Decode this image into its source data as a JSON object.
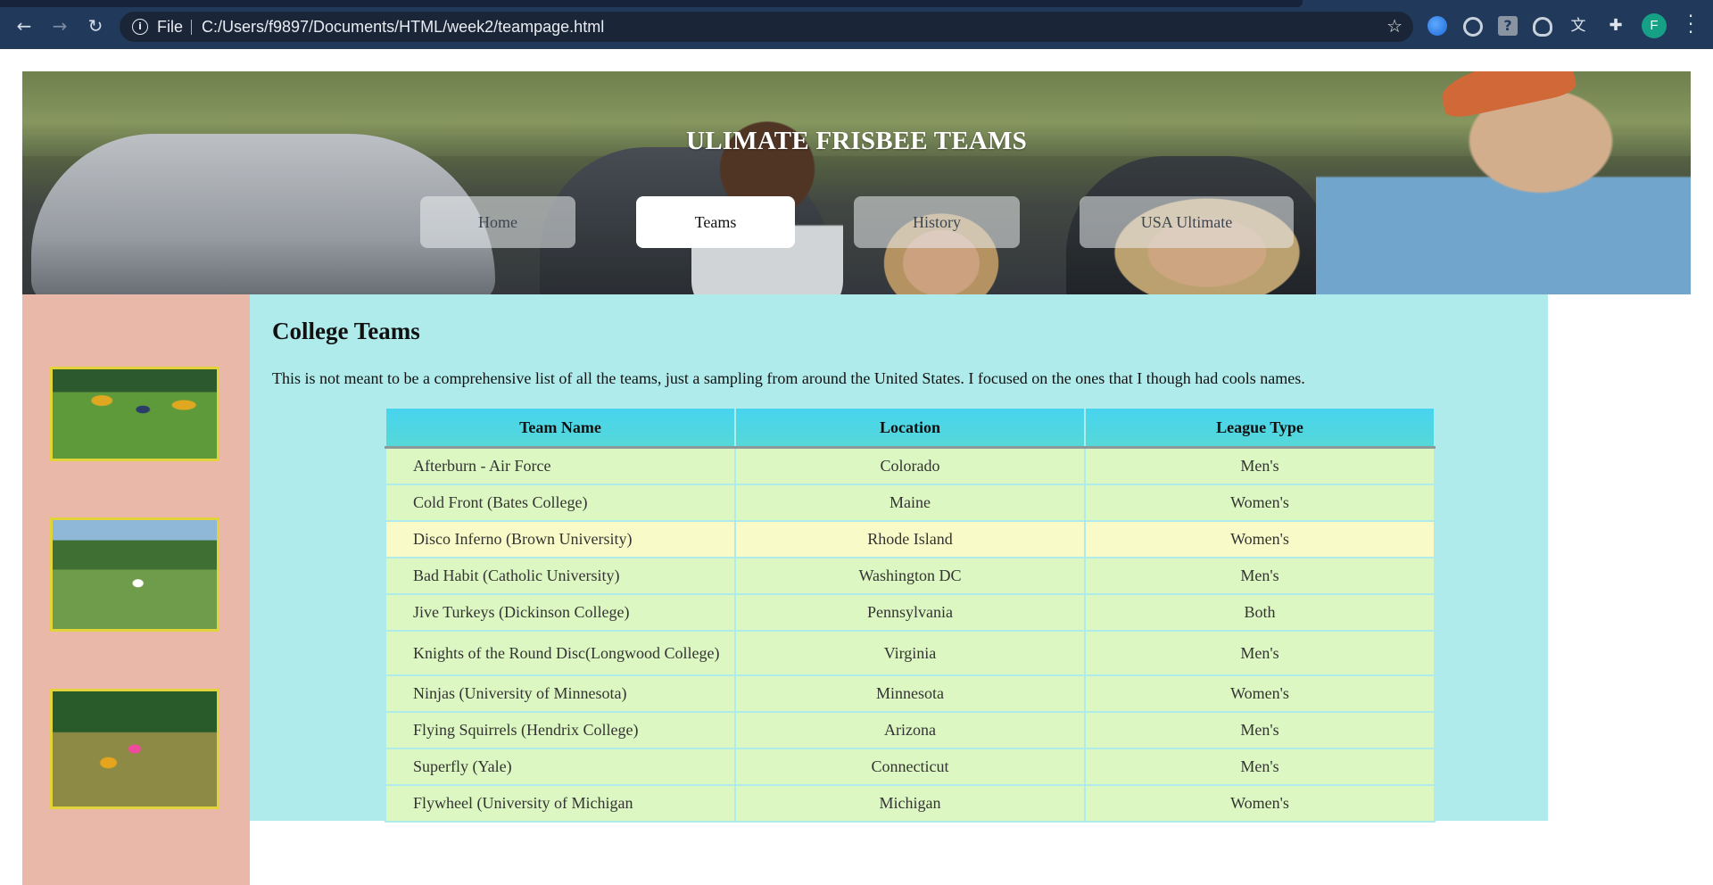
{
  "browser": {
    "file_label": "File",
    "url": "C:/Users/f9897/Documents/HTML/week2/teampage.html",
    "profile_initial": "F"
  },
  "site": {
    "title": "ULIMATE FRISBEE TEAMS",
    "nav": [
      {
        "label": "Home",
        "active": false
      },
      {
        "label": "Teams",
        "active": true
      },
      {
        "label": "History",
        "active": false
      },
      {
        "label": "USA Ultimate",
        "active": false
      }
    ]
  },
  "sidebar": {
    "images": [
      "frisbee-players-photo",
      "frisbee-field-photo",
      "frisbee-catch-photo"
    ]
  },
  "main": {
    "heading": "College Teams",
    "intro": "This is not meant to be a comprehensive list of all the teams, just a sampling from around the United States. I focused on the ones that I though had cools names.",
    "table": {
      "headers": [
        "Team Name",
        "Location",
        "League Type"
      ],
      "rows": [
        [
          "Afterburn - Air Force",
          "Colorado",
          "Men's"
        ],
        [
          "Cold Front (Bates College)",
          "Maine",
          "Women's"
        ],
        [
          "Disco Inferno (Brown University)",
          "Rhode Island",
          "Women's"
        ],
        [
          "Bad Habit (Catholic University)",
          "Washington DC",
          "Men's"
        ],
        [
          "Jive Turkeys (Dickinson College)",
          "Pennsylvania",
          "Both"
        ],
        [
          "Knights of the Round Disc(Longwood College)",
          "Virginia",
          "Men's"
        ],
        [
          "Ninjas (University of Minnesota)",
          "Minnesota",
          "Women's"
        ],
        [
          "Flying Squirrels (Hendrix College)",
          "Arizona",
          "Men's"
        ],
        [
          "Superfly (Yale)",
          "Connecticut",
          "Men's"
        ],
        [
          "Flywheel (University of Michigan",
          "Michigan",
          "Women's"
        ]
      ]
    }
  },
  "colors": {
    "chrome_bg": "#213a5c",
    "sidebar_bg": "#e9b8a8",
    "content_bg": "#b0ebeb",
    "table_header": "#48d4ef",
    "row_bg": "#ddf7c2",
    "row_highlight": "#f8fbc8",
    "thumb_border": "#e2d33a"
  }
}
